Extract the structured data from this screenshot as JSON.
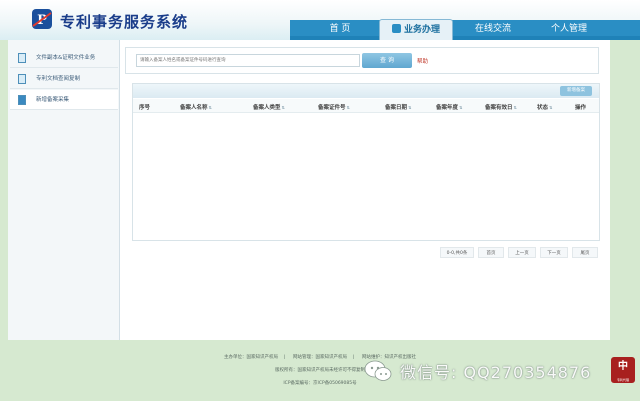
{
  "app": {
    "title": "专利事务服务系统"
  },
  "nav": {
    "items": [
      {
        "label": "首 页"
      },
      {
        "label": "业务办理"
      },
      {
        "label": "在线交流"
      },
      {
        "label": "个人管理"
      }
    ],
    "active": "业务办理"
  },
  "sidebar": {
    "items": [
      {
        "label": "文件副本&证明文件业务"
      },
      {
        "label": "专利文档查阅复制"
      },
      {
        "label": "新增备案采集"
      }
    ],
    "active_index": 2
  },
  "search": {
    "placeholder": "请输入备案人姓名或备案证件号码进行查询",
    "button_label": "查 询",
    "help_label": "帮助"
  },
  "table": {
    "new_button_label": "新增备案",
    "columns": [
      "序号",
      "备案人名称",
      "备案人类型",
      "备案证件号",
      "备案日期",
      "备案年度",
      "备案有效日",
      "状态",
      "操作"
    ],
    "rows": []
  },
  "pager": {
    "summary": "0-0,共0条",
    "first": "首页",
    "prev": "上一页",
    "next": "下一页",
    "last": "尾页"
  },
  "footer": {
    "line1": [
      "主办单位：国家知识产权局",
      "网站管理：国家知识产权局",
      "网站维护：知识产权出版社"
    ],
    "line2": "版权所有：国家知识产权局未经许可不得复制",
    "line3": "ICP备案编号：京ICP备05069085号"
  },
  "watermark": {
    "text": "微信号: QQ270354876",
    "stamp_char": "中",
    "stamp_sub": "专利代理"
  },
  "colors": {
    "nav_blue": "#2a8ec4",
    "title_blue": "#1a3d8a",
    "page_bg": "#d6e9d0",
    "help_red": "#c0392b"
  }
}
